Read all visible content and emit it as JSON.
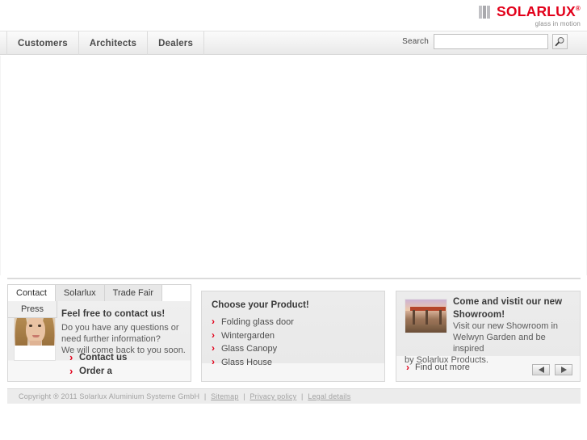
{
  "header": {
    "logo_name": "SOLARLUX",
    "logo_registered": "®",
    "logo_tagline": "glass in motion"
  },
  "nav": {
    "items": [
      {
        "label": "Customers"
      },
      {
        "label": "Architects"
      },
      {
        "label": "Dealers"
      }
    ],
    "search": {
      "label": "Search",
      "value": "",
      "placeholder": "",
      "button_icon": "search-icon"
    }
  },
  "teasers": {
    "contact": {
      "tabs": [
        {
          "label": "Contact",
          "active": true
        },
        {
          "label": "Solarlux",
          "active": false
        },
        {
          "label": "Trade Fair",
          "active": false
        }
      ],
      "subtab": {
        "label": "Press"
      },
      "heading": "Feel free to contact us!",
      "body_line1": "Do you have any questions or",
      "body_line2": "need further information?",
      "body_line3": "We will come back to you soon.",
      "links": [
        {
          "label": "Contact us"
        },
        {
          "label": "Order a"
        }
      ]
    },
    "products": {
      "heading": "Choose your Product!",
      "items": [
        {
          "label": "Folding glass door"
        },
        {
          "label": "Wintergarden"
        },
        {
          "label": "Glass Canopy"
        },
        {
          "label": "Glass House"
        }
      ]
    },
    "showroom": {
      "heading_line1": "Come and vistit our new",
      "heading_line2": "Showroom!",
      "body_line1": "Visit our new Showroom in",
      "body_line2": "Welwyn Garden and be inspired",
      "body_line3": "by Solarlux Products.",
      "link": "Find out more",
      "prev_icon": "arrow-left-icon",
      "next_icon": "arrow-right-icon"
    }
  },
  "footer": {
    "copyright": "Copyright ® 2011 Solarlux Aluminium Systeme GmbH",
    "links": [
      {
        "label": "Sitemap"
      },
      {
        "label": "Privacy policy"
      },
      {
        "label": "Legal details"
      }
    ],
    "separator": "|"
  },
  "colors": {
    "brand_red": "#e2001a",
    "nav_text": "#4a4a4a",
    "panel_bg": "#ececec"
  }
}
